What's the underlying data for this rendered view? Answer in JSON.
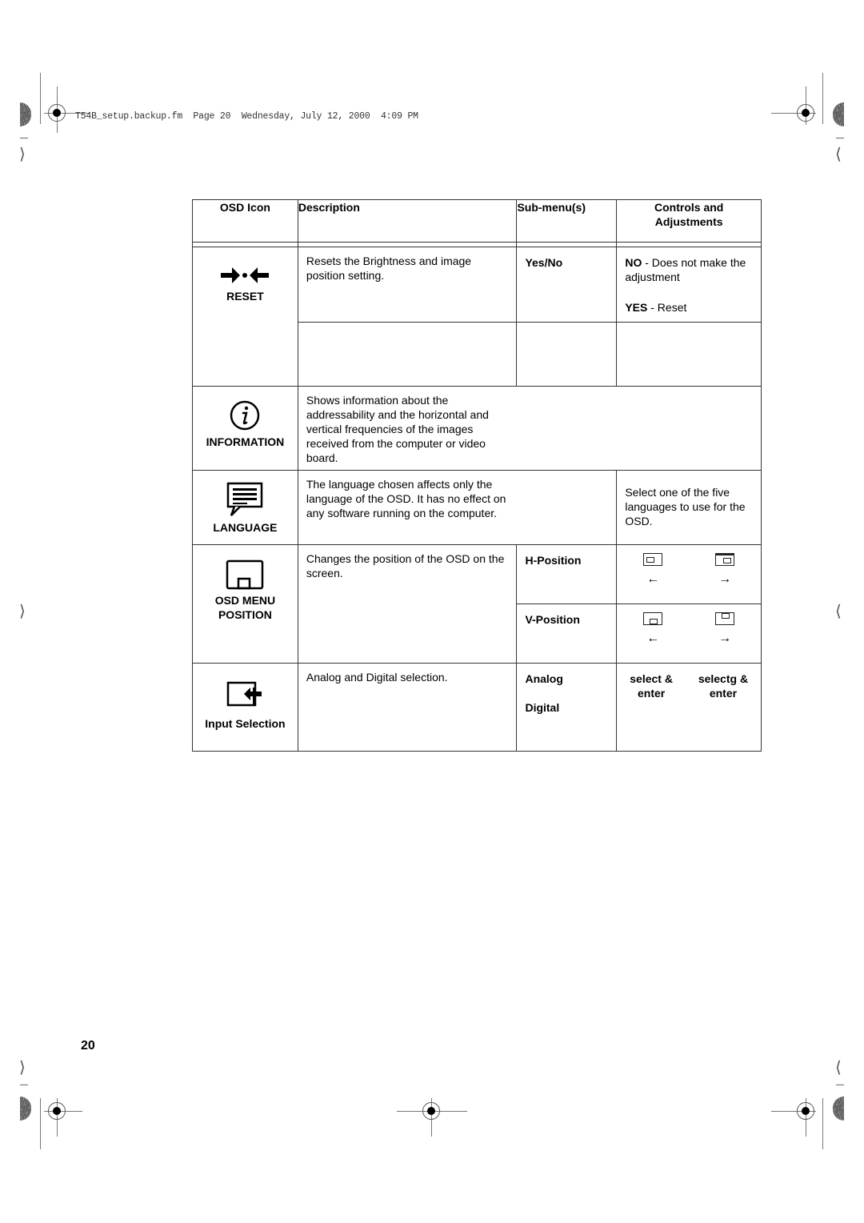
{
  "print_header": {
    "text": "T54B_setup.backup.fm  Page 20  Wednesday, July 12, 2000  4:09 PM"
  },
  "table": {
    "headers": {
      "osd_icon": "OSD Icon",
      "description": "Description",
      "submenus": "Sub-menu(s)",
      "controls_line1": "Controls and",
      "controls_line2": "Adjustments"
    },
    "rows": {
      "reset": {
        "icon": "reset-arrows-icon",
        "label": "RESET",
        "description": "Resets the Brightness and  image position setting.",
        "submenu": "Yes/No",
        "controls": {
          "no_key": "NO",
          "no_text": " - Does not make the adjustment",
          "yes_key": "YES",
          "yes_text": " - Reset"
        }
      },
      "information": {
        "icon": "info-circle-icon",
        "label": "INFORMATION",
        "description": "Shows information about the addressability and the horizontal and vertical frequencies of the images received from the computer or video board."
      },
      "language": {
        "icon": "speech-bubble-icon",
        "label": "LANGUAGE",
        "description": "The language chosen affects only the language of the OSD. It has no effect on any software running on the computer.",
        "controls": "Select one of the five languages to use for the OSD."
      },
      "osd_position": {
        "icon": "osd-window-icon",
        "label_line1": "OSD MENU",
        "label_line2": "POSITION",
        "description": "Changes the position of the OSD on the screen.",
        "h_submenu": "H-Position",
        "v_submenu": "V-Position",
        "left_arrow": "←",
        "right_arrow": "→"
      },
      "input_selection": {
        "icon": "input-arrow-icon",
        "label": "Input Selection",
        "description": "Analog and Digital selection.",
        "submenu_analog": "Analog",
        "submenu_digital": "Digital",
        "control_left_line1": "select &",
        "control_left_line2": "enter",
        "control_right_line1": "selectg &",
        "control_right_line2": "enter"
      }
    }
  },
  "page_number": "20"
}
